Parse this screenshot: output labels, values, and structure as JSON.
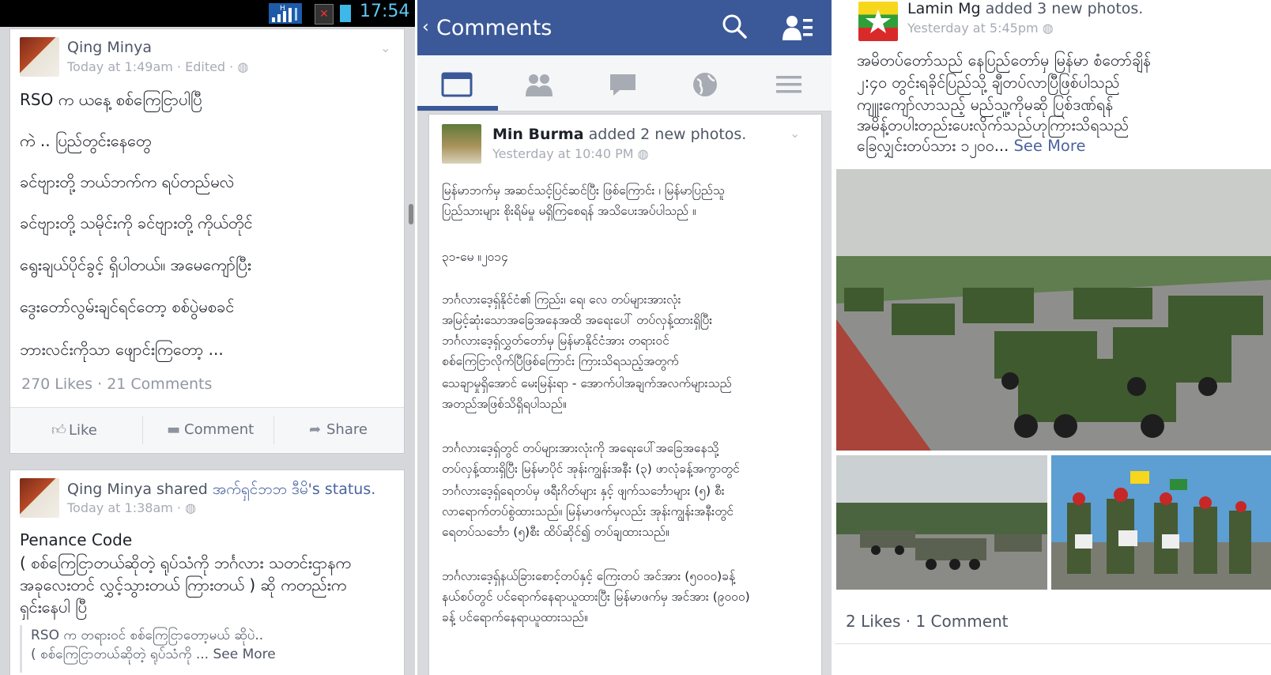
{
  "status_bar": {
    "time": "17:54",
    "signal_label": "H"
  },
  "post1": {
    "author": "Qing Minya",
    "meta": "Today at 1:49am · Edited ·",
    "lines": [
      "RSO က ယနေ့ စစ်ကြေငြာပါပြီ",
      "ကဲ .. ပြည်တွင်းနေတွေ",
      "ခင်ဗျားတို့ ဘယ်ဘက်က ရပ်တည်မလဲ",
      "ခင်ဗျားတို့ သမိုင်းကို ခင်ဗျားတို့ ကိုယ်တိုင်",
      "ရွေးချယ်ပိုင်ခွင့် ရှိပါတယ်။ အမေကျော်ပြီး",
      "ဒွေးတော်လွမ်းချင်ရင်တော့ စစ်ပွဲမစခင်",
      "ဘားလင်းကိုသာ ဖျောင်းကြတော့ ..."
    ],
    "stats": "270 Likes · 21 Comments",
    "actions": {
      "like": "Like",
      "comment": "Comment",
      "share": "Share"
    }
  },
  "post2": {
    "author": "Qing Minya",
    "shared_text": "shared",
    "shared_link": "အက်ရှင်ဘဘ ဒီမိ's status.",
    "meta": "Today at 1:38am ·",
    "lines": [
      "Penance Code",
      "( စစ်ကြေငြာတယ်ဆိုတဲ့ ရုပ်သံကို ဘင်္ဂလား သတင်းဌာနက",
      "အခုလေးတင် လွှင့်သွားတယ် ကြားတယ် ) ဆို ကတည်းက",
      "ရှင်းနေပါ ပြီ"
    ],
    "quote_lines": [
      "RSO က တရားဝင် စစ်ကြေငြာတော့မယ် ဆိုပဲ..",
      "( စစ်ကြေငြာတယ်ဆိုတဲ့ ရုပ်သံကို ... See More"
    ]
  },
  "comments_view": {
    "back_glyph": "‹",
    "title": "Comments",
    "post": {
      "author": "Min Burma",
      "action": "added 2 new photos.",
      "meta": "Yesterday at 10:40 PM",
      "paragraphs": [
        [
          "မြန်မာဘက်မှ အဆင်သင့်ပြင်ဆင်ပြီး ဖြစ်ကြောင်း ၊ မြန်မာပြည်သူ",
          "ပြည်သားများ စိုးရိမ်မှု မရှိကြစေရန် အသိပေးအပ်ပါသည် ။"
        ],
        [
          "၃၁-မေ ။၂၀၁၄"
        ],
        [
          "ဘင်္ဂလားဒေ့ရှ်နိုင်ငံ၏ ကြည်း၊ ရေ၊ လေ တပ်များအားလုံး",
          "အမြင့်ဆုံးသောအခြေအနေအထိ အရေးပေါ် တပ်လှန့်ထားရှိပြီး",
          "ဘင်္ဂလားဒေ့ရှ်လွှတ်တော်မှ မြန်မာနိုင်ငံအား တရားဝင်",
          "စစ်ကြေငြာလိုက်ပြီဖြစ်ကြောင်း ကြားသိရသည့်အတွက်",
          "သေချာမှုရှိအောင် မေးမြန်းရာ - အောက်ပါအချက်အလက်များသည်",
          "အတည်အဖြစ်သိရှိရပါသည်။"
        ],
        [
          "ဘင်္ဂလားဒေ့ရှ်တွင် တပ်များအားလုံးကို အရေးပေါ်အခြေအနေသို့",
          "တပ်လှန့်ထားရှိပြီး မြန်မာပိုင် အုန်းကျွန်းအနီး (၃) ဖာလုံခန့်အကွာတွင်",
          "ဘင်္ဂလားဒေ့ရှ်ရေတပ်မှ ဖရီးဂိတ်များ နှင့် ဖျက်သင်္ဘောများ (၅) စီး",
          "လာရောက်တပ်စွဲထားသည်။ မြန်မာဖက်မှလည်း အုန်းကျွန်းအနီးတွင်",
          "ရေတပ်သင်္ဘော (၅)စီး ထိပ်ဆိုင်၍ တပ်ချထားသည်။"
        ],
        [
          "ဘင်္ဂလားဒေ့ရှ်နယ်ခြားစောင့်တပ်နှင့် ကြေးတပ် အင်အား (၅၀၀၀)ခန့်",
          "နယ်စပ်တွင် ပင်ရောက်နေရာယူထားပြီး မြန်မာဖက်မှ အင်အား (၉၀၀၀)",
          "ခန့် ပင်ရောက်နေရာယူထားသည်။"
        ]
      ]
    }
  },
  "post3": {
    "author": "Lamin Mg",
    "action": "added 3 new photos.",
    "meta": "Yesterday at 5:45pm",
    "lines": [
      "အမိတပ်တော်သည် နေပြည်တော်မှ မြန်မာ စံတော်ချိန်",
      "၂:၄၀ တွင်းရခိုင်ပြည်သို့ ချီတပ်လာပြီဖြစ်ပါသည်",
      "ကျူးကျော်လာသည့် မည်သူ့ကိုမဆို ပြစ်ဒဏ်ရန်",
      "အမိန့်တပါးတည်းပေးလိုက်သည်ဟုကြားသိရသည်",
      "ခြေလျှင်းတပ်သား ၁၂၀၀..."
    ],
    "see_more": "See More",
    "stats": "2 Likes · 1 Comment"
  },
  "colors": {
    "facebook_blue": "#3b5998",
    "link": "#4a63a0",
    "muted": "#9197a3"
  }
}
